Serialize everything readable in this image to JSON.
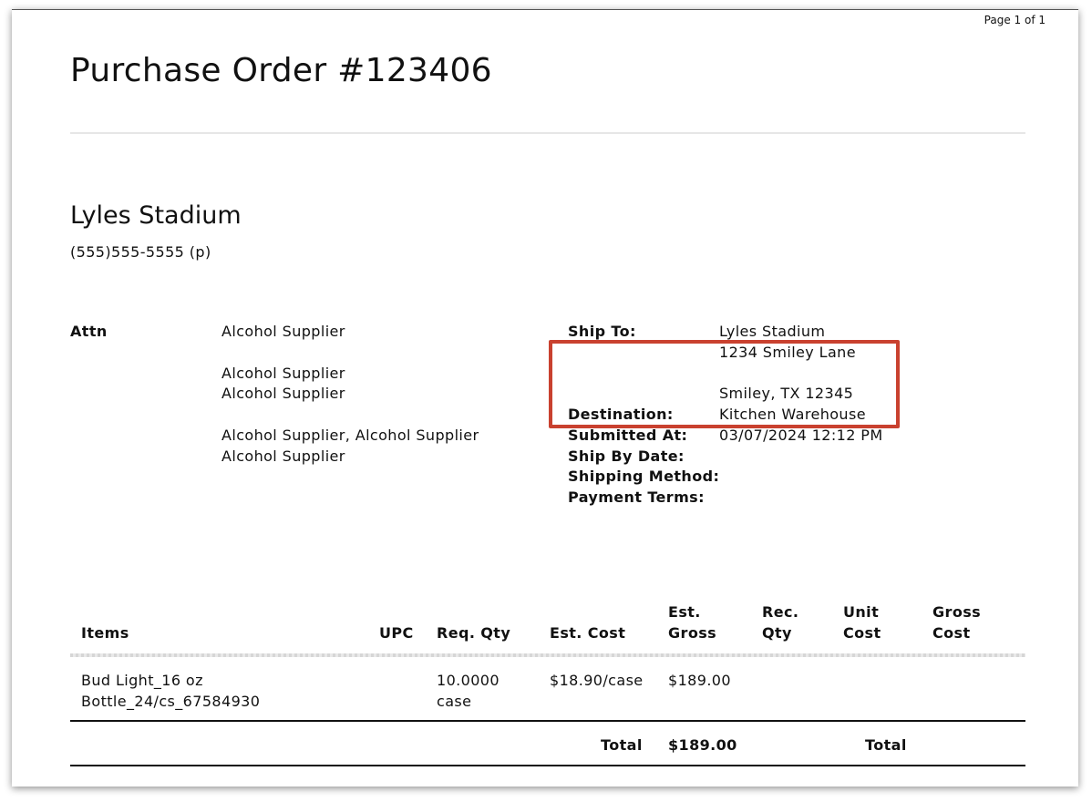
{
  "page_indicator": "Page 1 of 1",
  "title": "Purchase Order #123406",
  "company": {
    "name": "Lyles Stadium",
    "phone": "(555)555-5555 (p)"
  },
  "attn": {
    "label": "Attn",
    "lines": [
      "Alcohol Supplier",
      "Alcohol Supplier",
      "Alcohol Supplier",
      "Alcohol Supplier, Alcohol Supplier",
      "Alcohol Supplier"
    ]
  },
  "shipping": {
    "ship_to_label": "Ship To:",
    "ship_to_name": "Lyles Stadium",
    "ship_to_street": "1234 Smiley Lane",
    "ship_to_city": "Smiley, TX 12345",
    "destination_label": "Destination:",
    "destination_value": "Kitchen Warehouse",
    "submitted_label": "Submitted At:",
    "submitted_value": "03/07/2024 12:12 PM",
    "ship_by_label": "Ship By Date:",
    "shipping_method_label": "Shipping Method:",
    "payment_terms_label": "Payment Terms:"
  },
  "highlight_color": "#c9412f",
  "table": {
    "headers": {
      "items": "Items",
      "upc": "UPC",
      "req_qty": "Req. Qty",
      "est_cost": "Est. Cost",
      "est_gross_1": "Est.",
      "est_gross_2": "Gross",
      "rec_qty_1": "Rec.",
      "rec_qty_2": "Qty",
      "unit_cost_1": "Unit",
      "unit_cost_2": "Cost",
      "gross_cost_1": "Gross",
      "gross_cost_2": "Cost"
    },
    "rows": [
      {
        "item_line1": "Bud Light_16 oz",
        "item_line2": "Bottle_24/cs_67584930",
        "upc": "",
        "req_qty_line1": "10.0000",
        "req_qty_line2": "case",
        "est_cost": "$18.90/case",
        "est_gross": "$189.00"
      }
    ],
    "total_label": "Total",
    "total_value": "$189.00",
    "total_label_2": "Total"
  }
}
